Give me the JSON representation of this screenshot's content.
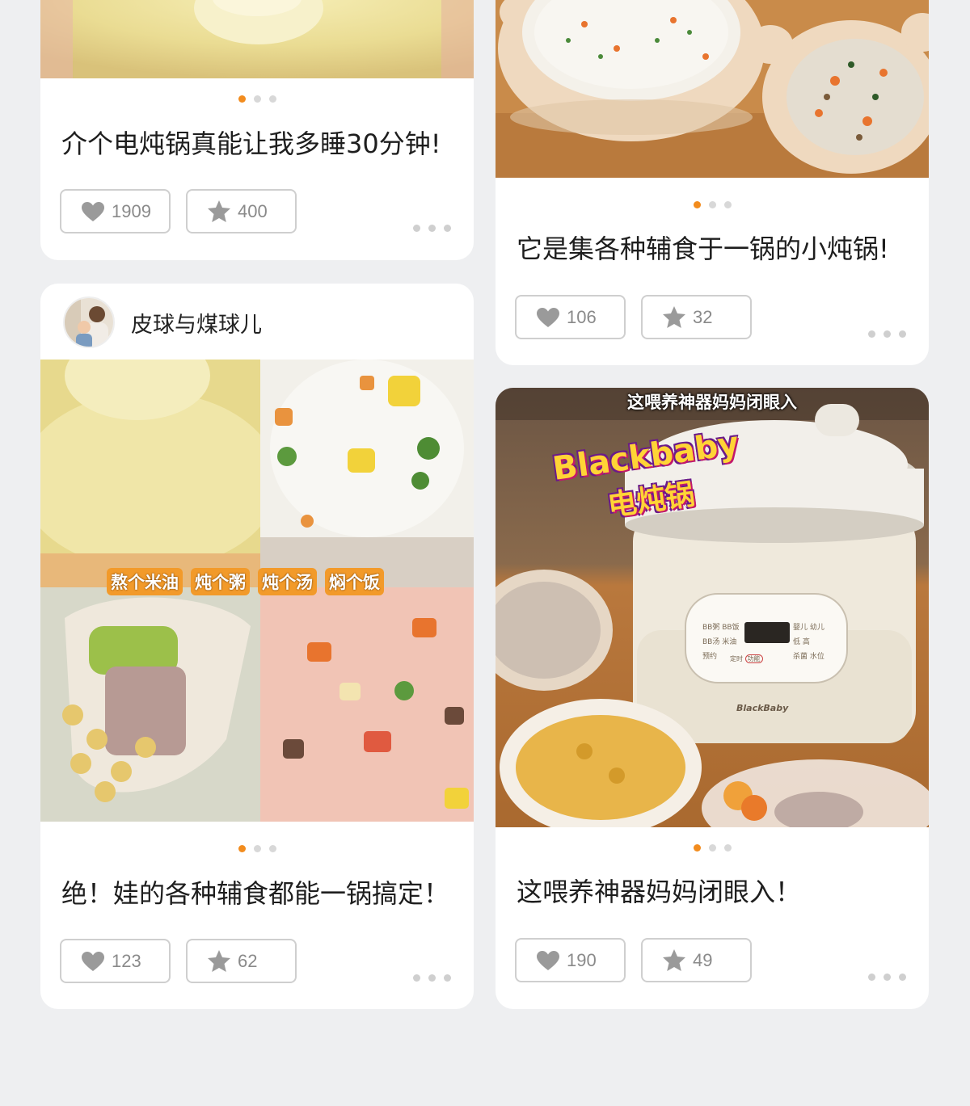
{
  "posts": [
    {
      "title": "介个电炖锅真能让我多睡30分钟!",
      "likes": "1909",
      "favorites": "400"
    },
    {
      "title": "它是集各种辅食于一锅的小炖锅!",
      "likes": "106",
      "favorites": "32"
    },
    {
      "author": "皮球与煤球儿",
      "title": "绝！娃的各种辅食都能一锅搞定！",
      "likes": "123",
      "favorites": "62",
      "image_caption": [
        "熬个米油",
        "炖个粥",
        "炖个汤",
        "焖个饭"
      ]
    },
    {
      "title": "这喂养神器妈妈闭眼入！",
      "likes": "190",
      "favorites": "49",
      "image_banner": "这喂养神器妈妈闭眼入",
      "image_brand": "Blackbaby",
      "image_brand_sub": "电炖锅",
      "cooker_logo": "BlackBaby",
      "cooker_labels": [
        "BB粥",
        "BB饭",
        "BB汤",
        "米油",
        "婴儿",
        "幼儿",
        "低",
        "高",
        "预约",
        "定时",
        "功能",
        "杀菌",
        "水位"
      ]
    }
  ],
  "icons": {
    "like": "heart-icon",
    "favorite": "star-icon",
    "more": "more-dots-icon"
  },
  "colors": {
    "accent": "#f28c1e",
    "background": "#eeeff1",
    "card": "#ffffff",
    "icon_gray": "#9a9a9a"
  }
}
